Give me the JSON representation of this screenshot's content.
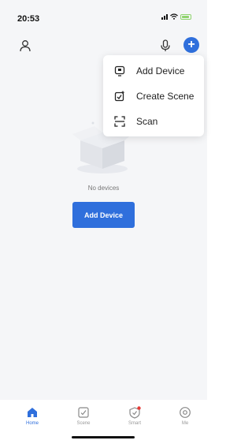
{
  "status_bar": {
    "time": "20:53"
  },
  "menu": {
    "items": [
      {
        "label": "Add Device",
        "icon": "add-device-icon"
      },
      {
        "label": "Create Scene",
        "icon": "create-scene-icon"
      },
      {
        "label": "Scan",
        "icon": "scan-icon"
      }
    ]
  },
  "empty_state": {
    "message": "No devices",
    "button_label": "Add Device"
  },
  "bottom_nav": {
    "items": [
      {
        "label": "Home",
        "icon": "home-icon",
        "active": true
      },
      {
        "label": "Scene",
        "icon": "scene-icon",
        "active": false
      },
      {
        "label": "Smart",
        "icon": "smart-icon",
        "active": false
      },
      {
        "label": "Me",
        "icon": "me-icon",
        "active": false
      }
    ]
  },
  "colors": {
    "accent": "#2f6fdc",
    "background": "#f5f6f8",
    "battery": "#8fd36e"
  }
}
